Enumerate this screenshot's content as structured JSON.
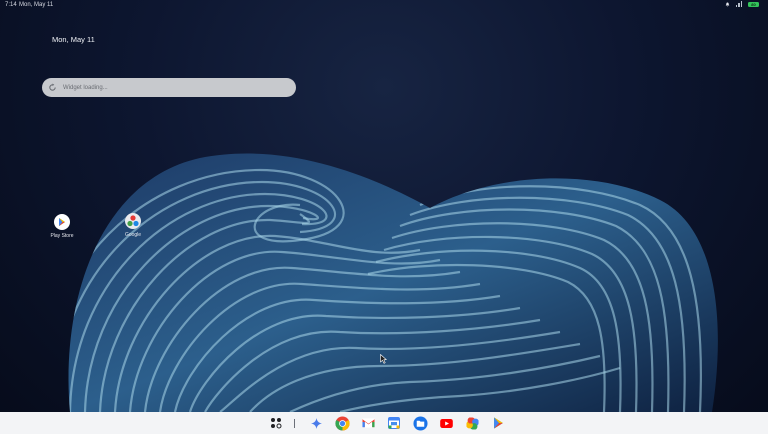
{
  "status_bar": {
    "time": "7:14",
    "date": "Mon, May 11",
    "battery": "80"
  },
  "home": {
    "date": "Mon, May 11"
  },
  "widget": {
    "placeholder": "Widget loading...",
    "icon": "refresh-icon"
  },
  "desktop_apps": [
    {
      "label": "Play Store",
      "icon": "play-store-icon"
    },
    {
      "label": "Google",
      "icon": "google-folder-icon"
    }
  ],
  "taskbar": {
    "apps": [
      "launcher-icon",
      "gemini-icon",
      "chrome-icon",
      "gmail-icon",
      "calendar-icon",
      "files-icon",
      "youtube-icon",
      "photos-icon",
      "play-store-icon"
    ]
  },
  "colors": {
    "wallpaper_dark": "#0d1630",
    "wave_light": "#9fd0e6",
    "taskbar": "#f3f4f6",
    "battery": "#33c35a"
  }
}
